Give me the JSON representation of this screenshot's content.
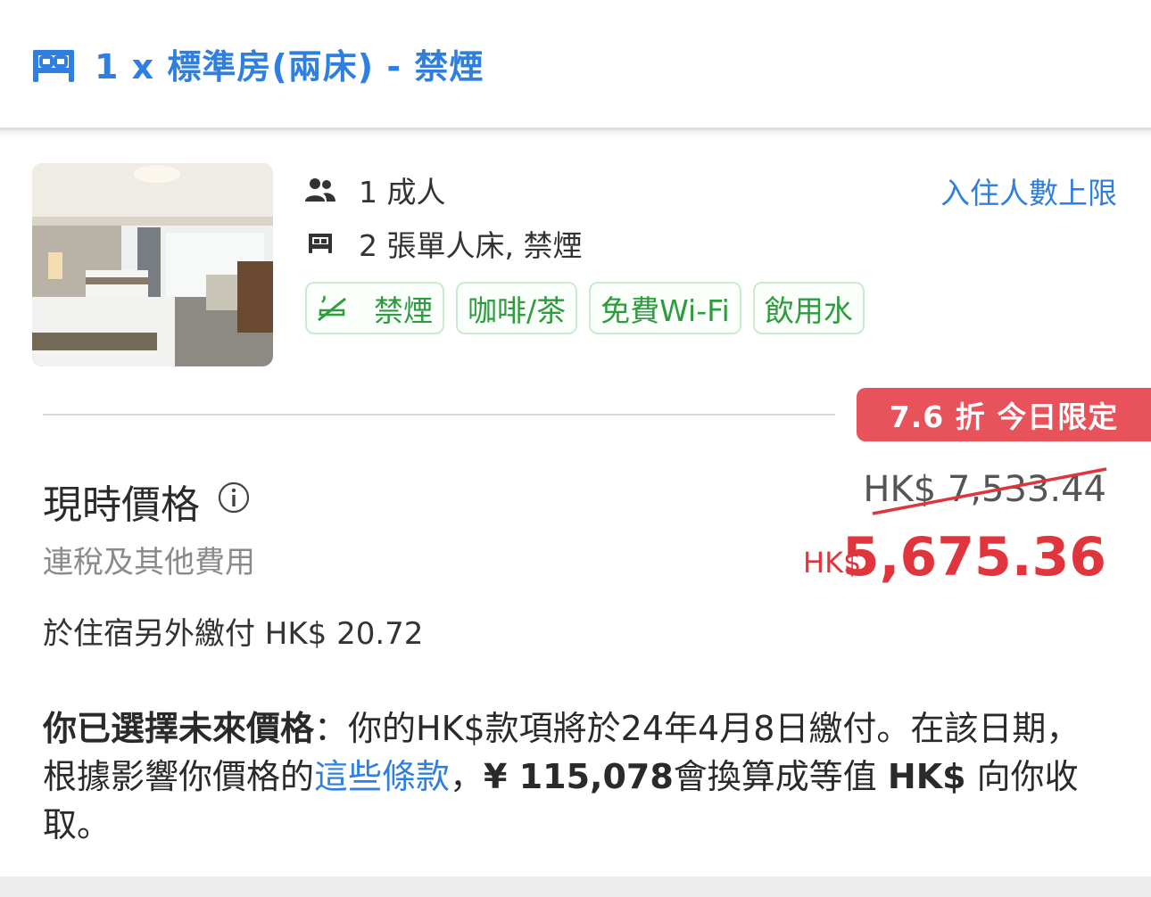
{
  "room": {
    "title": "1 x 標準房(兩床) - 禁煙",
    "icon": "bed-icon",
    "max_occupancy_link": "入住人數上限",
    "adults": "1 成人",
    "beds": "2 張單人床, 禁煙",
    "photo_icon": "hotel-room-photo"
  },
  "amenities": [
    {
      "label": "禁煙",
      "icon": "no-smoking-icon"
    },
    {
      "label": "咖啡/茶"
    },
    {
      "label": "免費Wi-Fi"
    },
    {
      "label": "飲用水"
    }
  ],
  "deal": {
    "badge": "7.6 折 今日限定"
  },
  "pricing": {
    "label": "現時價格",
    "sub_label": "連稅及其他費用",
    "old_price": "HK$ 7,533.44",
    "new_currency": "HK$",
    "new_price": "5,675.36",
    "extra_fee": "於住宿另外繳付 HK$ 20.72"
  },
  "notice": {
    "bold_lead": "你已選擇未來價格",
    "text_1": "：你的HK$款項將於24年4月8日繳付。在該日期，根據影響你價格的",
    "link": "這些條款",
    "text_2": "，",
    "amount": "¥ 115,078",
    "text_3": "會換算成等值 ",
    "currency": "HK$",
    "text_4": " 向你收取。"
  },
  "colors": {
    "accent_blue": "#2f7fe0",
    "price_red": "#e0353d",
    "badge_red": "#e8535b",
    "amenity_green": "#2e9b3e"
  }
}
